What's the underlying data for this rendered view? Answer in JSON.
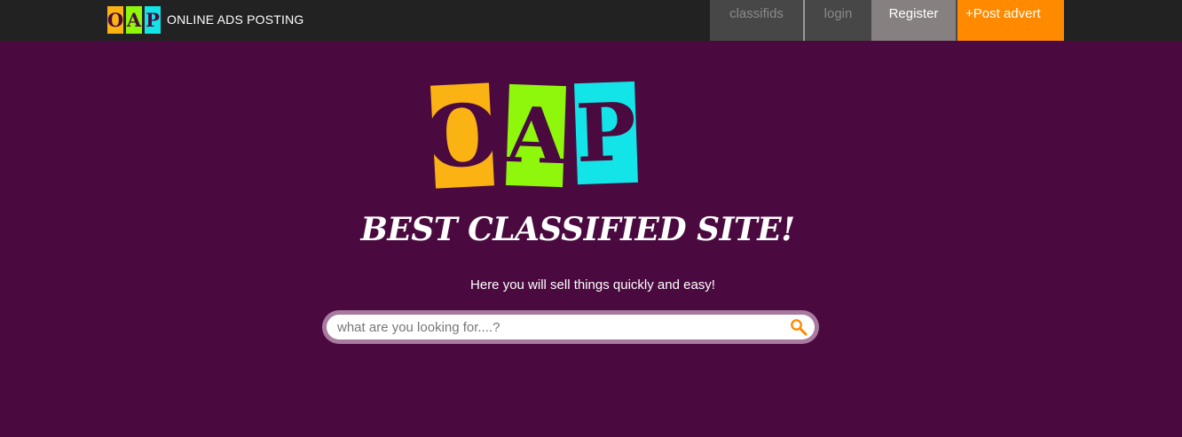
{
  "brand": {
    "logo_letters": [
      "O",
      "A",
      "P"
    ],
    "title": "ONLINE ADS POSTING"
  },
  "nav": {
    "classifieds": "classifids",
    "login": "login",
    "register": "Register",
    "post_advert": "+Post advert"
  },
  "hero": {
    "logo_letters": [
      "O",
      "A",
      "P"
    ],
    "headline": "BEST CLASSIFIED SITE!",
    "subline": "Here you will sell things quickly and easy!"
  },
  "search": {
    "placeholder": "what are you looking for....?",
    "value": ""
  },
  "colors": {
    "background": "#4a0a3f",
    "topbar": "#222222",
    "accent_orange": "#ff8a00",
    "tile_yellow": "#fbb313",
    "tile_green": "#8ff70c",
    "tile_cyan": "#13e4e8"
  },
  "icons": {
    "search": "search-icon"
  }
}
